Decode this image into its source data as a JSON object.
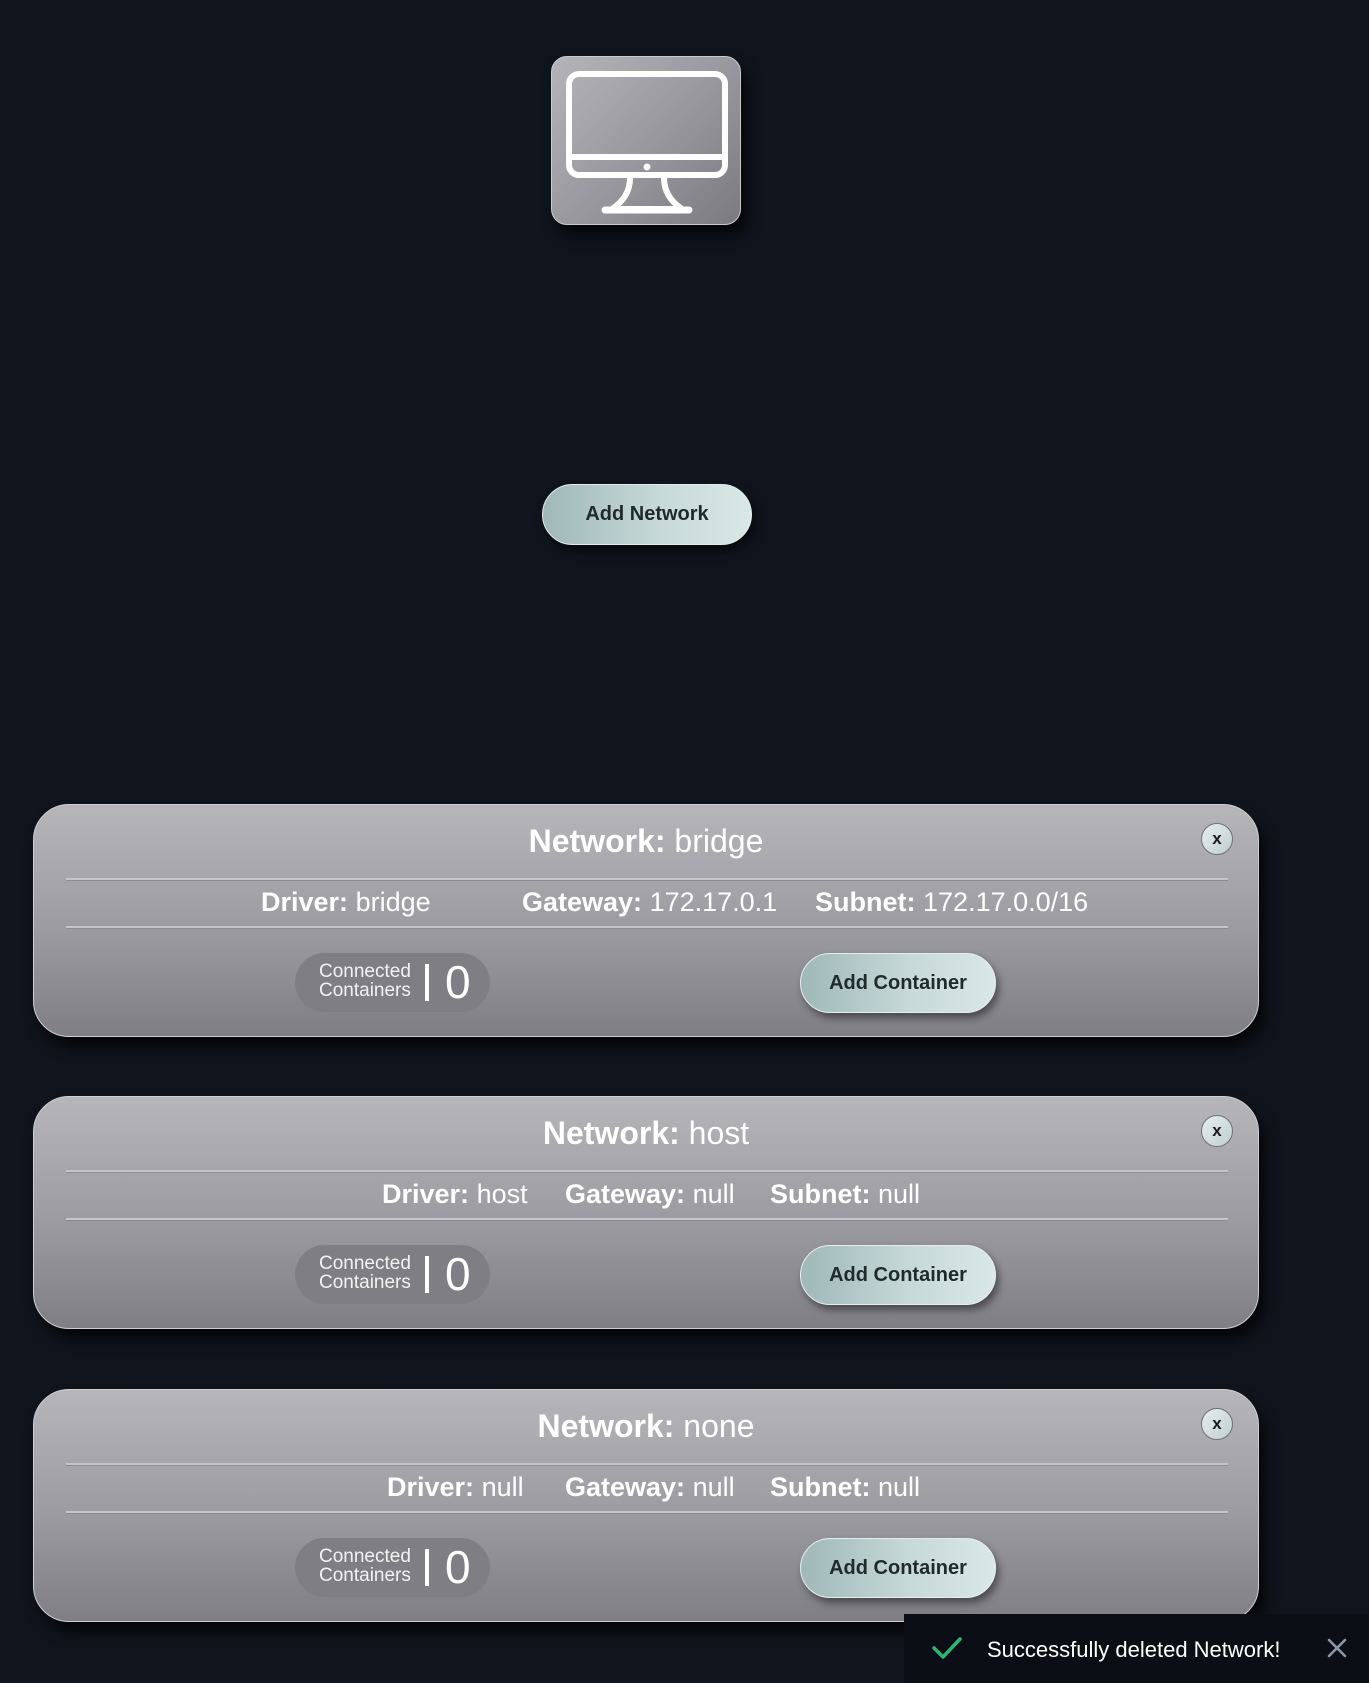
{
  "host": {
    "icon": "desktop-monitor-icon"
  },
  "add_network_label": "Add Network",
  "networks": [
    {
      "title_label": "Network:",
      "name": "bridge",
      "close_label": "x",
      "driver_label": "Driver:",
      "driver": "bridge",
      "gateway_label": "Gateway:",
      "gateway": "172.17.0.1",
      "subnet_label": "Subnet:",
      "subnet": "172.17.0.0/16",
      "connected_label_1": "Connected",
      "connected_label_2": "Containers",
      "connected_count": "0",
      "add_container_label": "Add Container"
    },
    {
      "title_label": "Network:",
      "name": "host",
      "close_label": "x",
      "driver_label": "Driver:",
      "driver": "host",
      "gateway_label": "Gateway:",
      "gateway": "null",
      "subnet_label": "Subnet:",
      "subnet": "null",
      "connected_label_1": "Connected",
      "connected_label_2": "Containers",
      "connected_count": "0",
      "add_container_label": "Add Container"
    },
    {
      "title_label": "Network:",
      "name": "none",
      "close_label": "x",
      "driver_label": "Driver:",
      "driver": "null",
      "gateway_label": "Gateway:",
      "gateway": "null",
      "subnet_label": "Subnet:",
      "subnet": "null",
      "connected_label_1": "Connected",
      "connected_label_2": "Containers",
      "connected_count": "0",
      "add_container_label": "Add Container"
    }
  ],
  "toast": {
    "message": "Successfully deleted Network!",
    "status_icon": "check-icon",
    "close_icon": "close-icon"
  },
  "colors": {
    "background": "#10151d",
    "card": "#9b9aa0",
    "button": "#c6d8d8",
    "toast_check": "#2bb673"
  }
}
